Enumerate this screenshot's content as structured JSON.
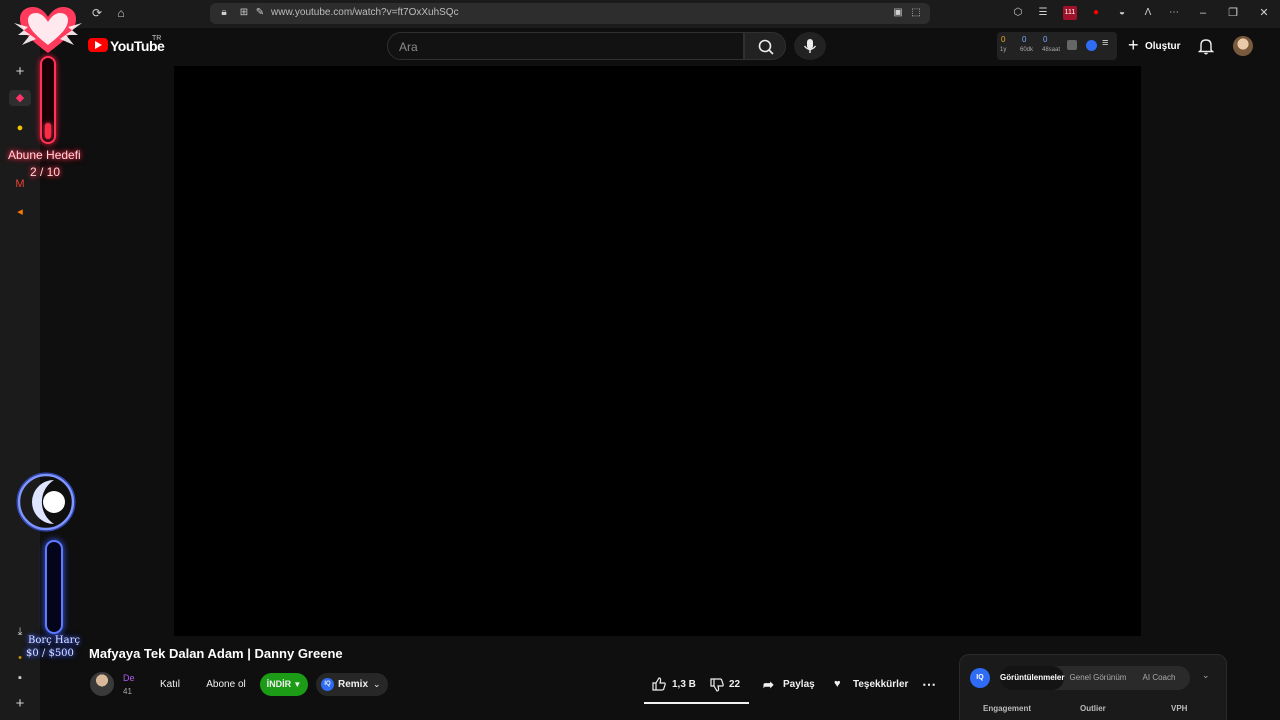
{
  "browser": {
    "url": "www.youtube.com/watch?v=ft7OxXuhSQc",
    "extension_badge": "111"
  },
  "youtube": {
    "wordmark": "YouTube",
    "country": "TR",
    "search_placeholder": "Ara",
    "stats": [
      {
        "value": "0",
        "label": "1y"
      },
      {
        "value": "0",
        "label": "60dk"
      },
      {
        "value": "0",
        "label": "48saat"
      }
    ],
    "create_label": "Oluştur"
  },
  "video": {
    "title": "Mafyaya Tek Dalan Adam | Danny Greene",
    "channel_name": "De",
    "channel_subs": "41",
    "join_label": "Katıl",
    "subscribe_label": "Abone ol",
    "download_label": "İNDİR",
    "remix_label": "Remix",
    "likes": "1,3 B",
    "dislikes": "22",
    "share_label": "Paylaş",
    "thanks_label": "Teşekkürler"
  },
  "analytics": {
    "logo": "IQ",
    "tabs": [
      "Görüntülenmeler",
      "Genel Görünüm",
      "AI Coach"
    ],
    "active_tab": "Görüntülenmeler",
    "columns": [
      "Engagement",
      "Outlier",
      "VPH"
    ]
  },
  "overlays": {
    "sub_goal_title": "Abune Hedefi",
    "sub_goal_count": "2 / 10",
    "sub_goal_progress": 0.2,
    "debt_title": "Borç Harç",
    "debt_count": "$0 / $500",
    "debt_progress": 0.0
  },
  "colors": {
    "youtube_red": "#ff0000",
    "download_green": "#1c9c16",
    "iq_blue": "#2e6cf6",
    "goal_neon": "#ff2a44",
    "debt_neon": "#3b5bff"
  }
}
